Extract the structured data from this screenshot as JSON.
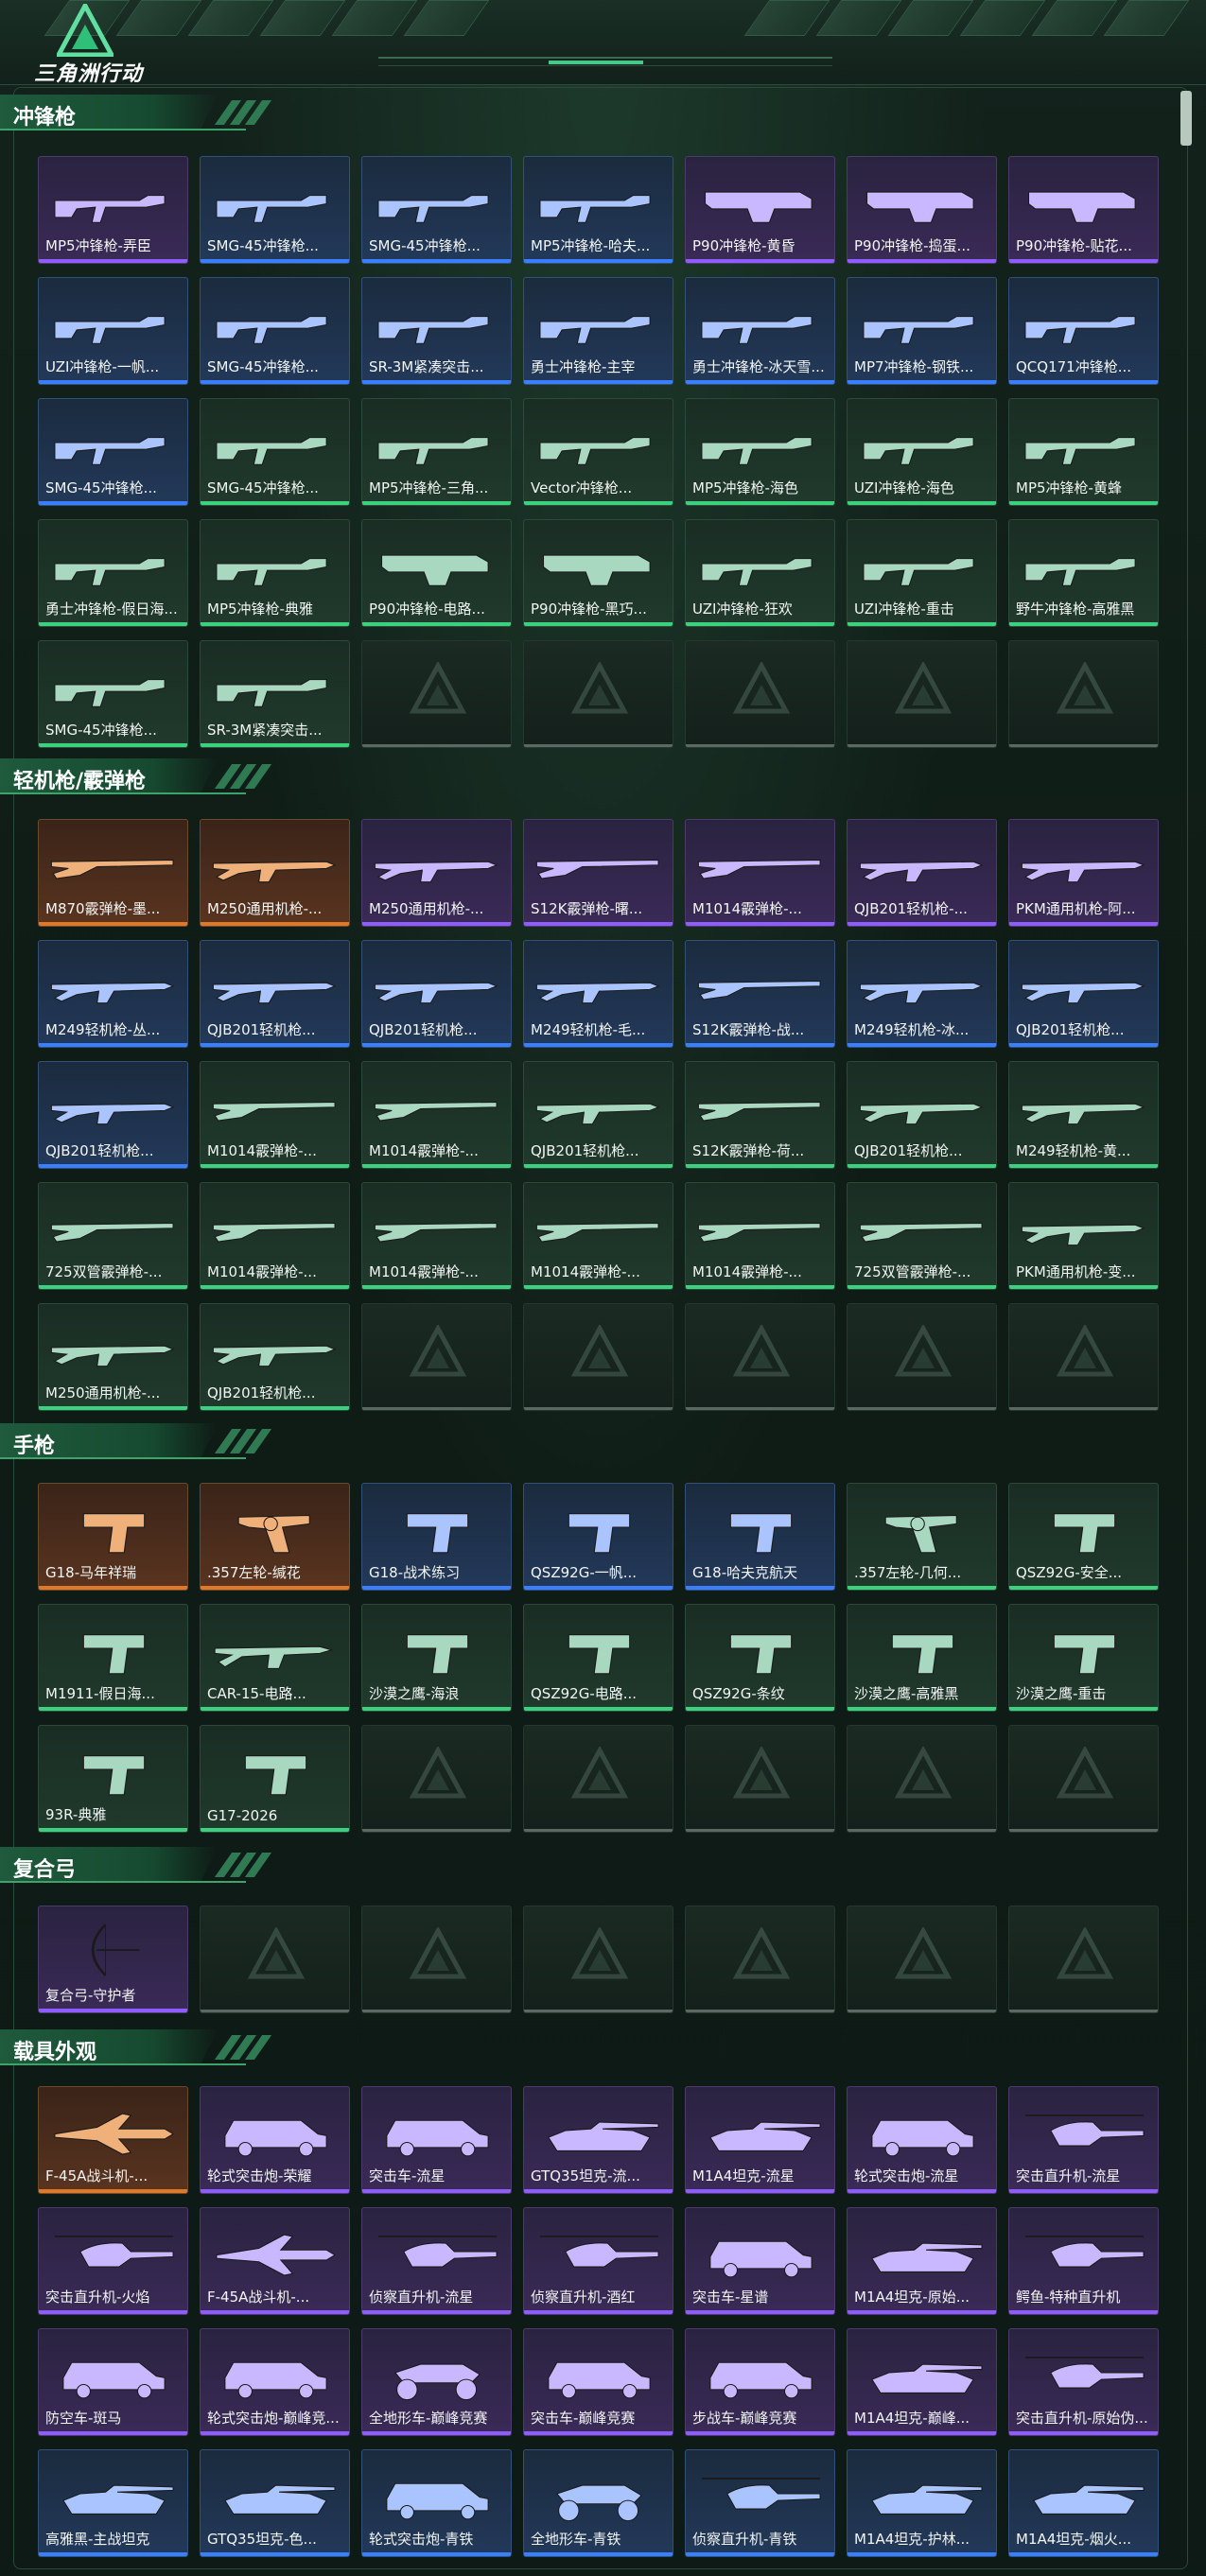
{
  "app": {
    "title": "三角洲行动"
  },
  "sections": [
    {
      "title": "冲锋枪",
      "items": [
        {
          "label": "MP5冲锋枪-弄臣",
          "rarity": "purple",
          "icon": "smg-icon"
        },
        {
          "label": "SMG-45冲锋枪...",
          "rarity": "blue",
          "icon": "smg-icon"
        },
        {
          "label": "SMG-45冲锋枪...",
          "rarity": "blue",
          "icon": "smg-icon"
        },
        {
          "label": "MP5冲锋枪-哈夫...",
          "rarity": "blue",
          "icon": "smg-icon"
        },
        {
          "label": "P90冲锋枪-黄昏",
          "rarity": "purple",
          "icon": "p90-icon"
        },
        {
          "label": "P90冲锋枪-捣蛋...",
          "rarity": "purple",
          "icon": "p90-icon"
        },
        {
          "label": "P90冲锋枪-贴花...",
          "rarity": "purple",
          "icon": "p90-icon"
        },
        {
          "label": "UZI冲锋枪-一帆...",
          "rarity": "blue",
          "icon": "smg-icon"
        },
        {
          "label": "SMG-45冲锋枪...",
          "rarity": "blue",
          "icon": "smg-icon"
        },
        {
          "label": "SR-3M紧凑突击...",
          "rarity": "blue",
          "icon": "smg-icon"
        },
        {
          "label": "勇士冲锋枪-主宰",
          "rarity": "blue",
          "icon": "smg-icon"
        },
        {
          "label": "勇士冲锋枪-冰天雪...",
          "rarity": "blue",
          "icon": "smg-icon"
        },
        {
          "label": "MP7冲锋枪-钢铁...",
          "rarity": "blue",
          "icon": "smg-icon"
        },
        {
          "label": "QCQ171冲锋枪...",
          "rarity": "blue",
          "icon": "smg-icon"
        },
        {
          "label": "SMG-45冲锋枪...",
          "rarity": "blue",
          "icon": "smg-icon"
        },
        {
          "label": "SMG-45冲锋枪...",
          "rarity": "green",
          "icon": "smg-icon"
        },
        {
          "label": "MP5冲锋枪-三角...",
          "rarity": "green",
          "icon": "smg-icon"
        },
        {
          "label": "Vector冲锋枪...",
          "rarity": "green",
          "icon": "smg-icon"
        },
        {
          "label": "MP5冲锋枪-海色",
          "rarity": "green",
          "icon": "smg-icon"
        },
        {
          "label": "UZI冲锋枪-海色",
          "rarity": "green",
          "icon": "smg-icon"
        },
        {
          "label": "MP5冲锋枪-黄蜂",
          "rarity": "green",
          "icon": "smg-icon"
        },
        {
          "label": "勇士冲锋枪-假日海...",
          "rarity": "green",
          "icon": "smg-icon"
        },
        {
          "label": "MP5冲锋枪-典雅",
          "rarity": "green",
          "icon": "smg-icon"
        },
        {
          "label": "P90冲锋枪-电路...",
          "rarity": "green",
          "icon": "p90-icon"
        },
        {
          "label": "P90冲锋枪-黑巧...",
          "rarity": "green",
          "icon": "p90-icon"
        },
        {
          "label": "UZI冲锋枪-狂欢",
          "rarity": "green",
          "icon": "smg-icon"
        },
        {
          "label": "UZI冲锋枪-重击",
          "rarity": "green",
          "icon": "smg-icon"
        },
        {
          "label": "野牛冲锋枪-高雅黑",
          "rarity": "green",
          "icon": "smg-icon"
        },
        {
          "label": "SMG-45冲锋枪...",
          "rarity": "green",
          "icon": "smg-icon"
        },
        {
          "label": "SR-3M紧凑突击...",
          "rarity": "green",
          "icon": "smg-icon"
        },
        null,
        null,
        null,
        null,
        null
      ]
    },
    {
      "title": "轻机枪/霰弹枪",
      "items": [
        {
          "label": "M870霰弹枪-墨...",
          "rarity": "gold",
          "icon": "shotgun-icon"
        },
        {
          "label": "M250通用机枪-...",
          "rarity": "gold",
          "icon": "lmg-icon"
        },
        {
          "label": "M250通用机枪-...",
          "rarity": "purple",
          "icon": "lmg-icon"
        },
        {
          "label": "S12K霰弹枪-曙...",
          "rarity": "purple",
          "icon": "shotgun-icon"
        },
        {
          "label": "M1014霰弹枪-...",
          "rarity": "purple",
          "icon": "shotgun-icon"
        },
        {
          "label": "QJB201轻机枪-...",
          "rarity": "purple",
          "icon": "lmg-icon"
        },
        {
          "label": "PKM通用机枪-阿...",
          "rarity": "purple",
          "icon": "lmg-icon"
        },
        {
          "label": "M249轻机枪-丛...",
          "rarity": "blue",
          "icon": "lmg-icon"
        },
        {
          "label": "QJB201轻机枪...",
          "rarity": "blue",
          "icon": "lmg-icon"
        },
        {
          "label": "QJB201轻机枪...",
          "rarity": "blue",
          "icon": "lmg-icon"
        },
        {
          "label": "M249轻机枪-毛...",
          "rarity": "blue",
          "icon": "lmg-icon"
        },
        {
          "label": "S12K霰弹枪-战...",
          "rarity": "blue",
          "icon": "shotgun-icon"
        },
        {
          "label": "M249轻机枪-冰...",
          "rarity": "blue",
          "icon": "lmg-icon"
        },
        {
          "label": "QJB201轻机枪...",
          "rarity": "blue",
          "icon": "lmg-icon"
        },
        {
          "label": "QJB201轻机枪...",
          "rarity": "blue",
          "icon": "lmg-icon"
        },
        {
          "label": "M1014霰弹枪-...",
          "rarity": "green",
          "icon": "shotgun-icon"
        },
        {
          "label": "M1014霰弹枪-...",
          "rarity": "green",
          "icon": "shotgun-icon"
        },
        {
          "label": "QJB201轻机枪...",
          "rarity": "green",
          "icon": "lmg-icon"
        },
        {
          "label": "S12K霰弹枪-荷...",
          "rarity": "green",
          "icon": "shotgun-icon"
        },
        {
          "label": "QJB201轻机枪...",
          "rarity": "green",
          "icon": "lmg-icon"
        },
        {
          "label": "M249轻机枪-黄...",
          "rarity": "green",
          "icon": "lmg-icon"
        },
        {
          "label": "725双管霰弹枪-...",
          "rarity": "green",
          "icon": "shotgun-icon"
        },
        {
          "label": "M1014霰弹枪-...",
          "rarity": "green",
          "icon": "shotgun-icon"
        },
        {
          "label": "M1014霰弹枪-...",
          "rarity": "green",
          "icon": "shotgun-icon"
        },
        {
          "label": "M1014霰弹枪-...",
          "rarity": "green",
          "icon": "shotgun-icon"
        },
        {
          "label": "M1014霰弹枪-...",
          "rarity": "green",
          "icon": "shotgun-icon"
        },
        {
          "label": "725双管霰弹枪-...",
          "rarity": "green",
          "icon": "shotgun-icon"
        },
        {
          "label": "PKM通用机枪-变...",
          "rarity": "green",
          "icon": "lmg-icon"
        },
        {
          "label": "M250通用机枪-...",
          "rarity": "green",
          "icon": "lmg-icon"
        },
        {
          "label": "QJB201轻机枪...",
          "rarity": "green",
          "icon": "lmg-icon"
        },
        null,
        null,
        null,
        null,
        null
      ]
    },
    {
      "title": "手枪",
      "items": [
        {
          "label": "G18-马年祥瑞",
          "rarity": "gold",
          "icon": "pistol-icon"
        },
        {
          "label": ".357左轮-缄花",
          "rarity": "gold",
          "icon": "revolver-icon"
        },
        {
          "label": "G18-战术练习",
          "rarity": "blue",
          "icon": "pistol-icon"
        },
        {
          "label": "QSZ92G-一帆...",
          "rarity": "blue",
          "icon": "pistol-icon"
        },
        {
          "label": "G18-哈夫克航天",
          "rarity": "blue",
          "icon": "pistol-icon"
        },
        {
          "label": ".357左轮-几何...",
          "rarity": "green",
          "icon": "revolver-icon"
        },
        {
          "label": "QSZ92G-安全...",
          "rarity": "green",
          "icon": "pistol-icon"
        },
        {
          "label": "M1911-假日海...",
          "rarity": "green",
          "icon": "pistol-icon"
        },
        {
          "label": "CAR-15-电路...",
          "rarity": "green",
          "icon": "rifle-icon"
        },
        {
          "label": "沙漠之鹰-海浪",
          "rarity": "green",
          "icon": "pistol-icon"
        },
        {
          "label": "QSZ92G-电路...",
          "rarity": "green",
          "icon": "pistol-icon"
        },
        {
          "label": "QSZ92G-条纹",
          "rarity": "green",
          "icon": "pistol-icon"
        },
        {
          "label": "沙漠之鹰-高雅黑",
          "rarity": "green",
          "icon": "pistol-icon"
        },
        {
          "label": "沙漠之鹰-重击",
          "rarity": "green",
          "icon": "pistol-icon"
        },
        {
          "label": "93R-典雅",
          "rarity": "green",
          "icon": "pistol-icon"
        },
        {
          "label": "G17-2026",
          "rarity": "green",
          "icon": "pistol-icon"
        },
        null,
        null,
        null,
        null,
        null
      ]
    },
    {
      "title": "复合弓",
      "items": [
        {
          "label": "复合弓-守护者",
          "rarity": "purple",
          "icon": "bow-icon"
        },
        null,
        null,
        null,
        null,
        null,
        null
      ]
    },
    {
      "title": "载具外观",
      "items": [
        {
          "label": "F-45A战斗机-...",
          "rarity": "gold",
          "icon": "jet-icon"
        },
        {
          "label": "轮式突击炮-荣耀",
          "rarity": "purple",
          "icon": "armored-car-icon"
        },
        {
          "label": "突击车-流星",
          "rarity": "purple",
          "icon": "armored-car-icon"
        },
        {
          "label": "GTQ35坦克-流...",
          "rarity": "purple",
          "icon": "tank-icon"
        },
        {
          "label": "M1A4坦克-流星",
          "rarity": "purple",
          "icon": "tank-icon"
        },
        {
          "label": "轮式突击炮-流星",
          "rarity": "purple",
          "icon": "armored-car-icon"
        },
        {
          "label": "突击直升机-流星",
          "rarity": "purple",
          "icon": "helicopter-icon"
        },
        {
          "label": "突击直升机-火焰",
          "rarity": "purple",
          "icon": "helicopter-icon"
        },
        {
          "label": "F-45A战斗机-...",
          "rarity": "purple",
          "icon": "jet-icon"
        },
        {
          "label": "侦察直升机-流星",
          "rarity": "purple",
          "icon": "helicopter-icon"
        },
        {
          "label": "侦察直升机-酒红",
          "rarity": "purple",
          "icon": "helicopter-icon"
        },
        {
          "label": "突击车-星谱",
          "rarity": "purple",
          "icon": "armored-car-icon"
        },
        {
          "label": "M1A4坦克-原始...",
          "rarity": "purple",
          "icon": "tank-icon"
        },
        {
          "label": "鳄鱼-特种直升机",
          "rarity": "purple",
          "icon": "helicopter-icon"
        },
        {
          "label": "防空车-斑马",
          "rarity": "purple",
          "icon": "armored-car-icon"
        },
        {
          "label": "轮式突击炮-巅峰竞...",
          "rarity": "purple",
          "icon": "armored-car-icon"
        },
        {
          "label": "全地形车-巅峰竞赛",
          "rarity": "purple",
          "icon": "atv-icon"
        },
        {
          "label": "突击车-巅峰竞赛",
          "rarity": "purple",
          "icon": "armored-car-icon"
        },
        {
          "label": "步战车-巅峰竞赛",
          "rarity": "purple",
          "icon": "armored-car-icon"
        },
        {
          "label": "M1A4坦克-巅峰...",
          "rarity": "purple",
          "icon": "tank-icon"
        },
        {
          "label": "突击直升机-原始伪...",
          "rarity": "purple",
          "icon": "helicopter-icon"
        },
        {
          "label": "高雅黑-主战坦克",
          "rarity": "blue",
          "icon": "tank-icon"
        },
        {
          "label": "GTQ35坦克-色...",
          "rarity": "blue",
          "icon": "tank-icon"
        },
        {
          "label": "轮式突击炮-青铁",
          "rarity": "blue",
          "icon": "armored-car-icon"
        },
        {
          "label": "全地形车-青铁",
          "rarity": "blue",
          "icon": "atv-icon"
        },
        {
          "label": "侦察直升机-青铁",
          "rarity": "blue",
          "icon": "helicopter-icon"
        },
        {
          "label": "M1A4坦克-护林...",
          "rarity": "blue",
          "icon": "tank-icon"
        },
        {
          "label": "M1A4坦克-烟火...",
          "rarity": "blue",
          "icon": "tank-icon"
        }
      ]
    }
  ],
  "colors": {
    "purple": "#8f5cff",
    "blue": "#3a7fff",
    "gold": "#e0782a",
    "green": "#3bd17f",
    "accent": "#3da36a"
  }
}
